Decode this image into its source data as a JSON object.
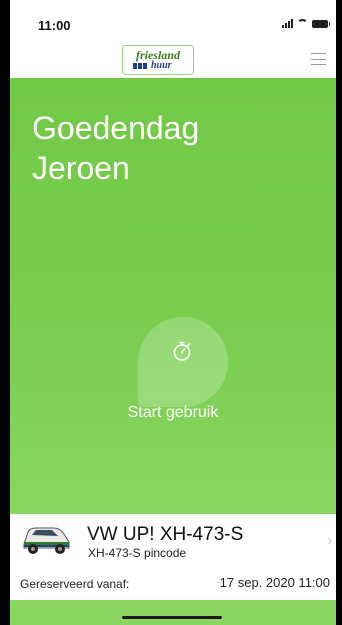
{
  "status_bar": {
    "time": "11:00"
  },
  "app_bar": {
    "logo_line1": "friesland",
    "logo_line2": "huur"
  },
  "home": {
    "greeting_line1": "Goedendag",
    "greeting_line2": "Jeroen",
    "start_label": "Start gebruik"
  },
  "reservation": {
    "car_title": "VW UP! XH-473-S",
    "pincode_label": "XH-473-S pincode",
    "reserved_from_label": "Gereserveerd vanaf:",
    "reserved_from_value": "17 sep. 2020 11:00"
  },
  "colors": {
    "brand_green": "#76cb4c",
    "brand_blue": "#1f3f8a"
  },
  "icons": [
    "menu-icon",
    "stopwatch-icon",
    "car-icon",
    "chevron-right-icon",
    "signal-icon",
    "wifi-icon",
    "battery-icon"
  ]
}
